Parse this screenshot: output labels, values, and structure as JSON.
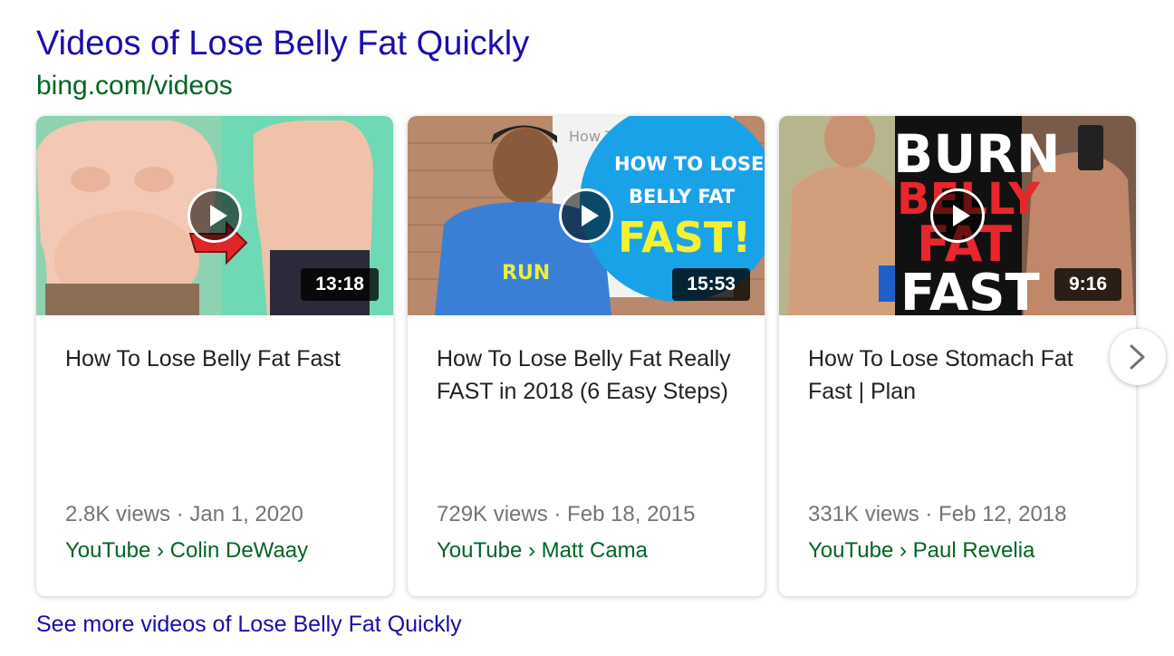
{
  "header": {
    "title": "Videos of Lose Belly Fat Quickly",
    "source": "bing.com/videos"
  },
  "videos": [
    {
      "title": "How To Lose Belly Fat Fast",
      "duration": "13:18",
      "views_date": "2.8K views · Jan 1, 2020",
      "channel": "YouTube › Colin DeWaay"
    },
    {
      "title": "How To Lose Belly Fat Really FAST in 2018 (6 Easy Steps)",
      "duration": "15:53",
      "views_date": "729K views · Feb 18, 2015",
      "channel": "YouTube › Matt Cama",
      "thumb_text": [
        "How To",
        "HOW TO LOSE",
        "BELLY FAT",
        "FAST!",
        "RUN"
      ]
    },
    {
      "title": "How To Lose Stomach Fat Fast | Plan",
      "duration": "9:16",
      "views_date": "331K views · Feb 12, 2018",
      "channel": "YouTube › Paul Revelia",
      "thumb_text": [
        "BURN",
        "BELLY",
        "FAT",
        "FAST"
      ]
    }
  ],
  "footer": {
    "see_more": "See more videos of Lose Belly Fat Quickly"
  },
  "icons": {
    "play": "play-icon",
    "next": "chevron-right-icon"
  },
  "colors": {
    "link": "#1a0dab",
    "source": "#006621",
    "meta": "#70757a"
  }
}
